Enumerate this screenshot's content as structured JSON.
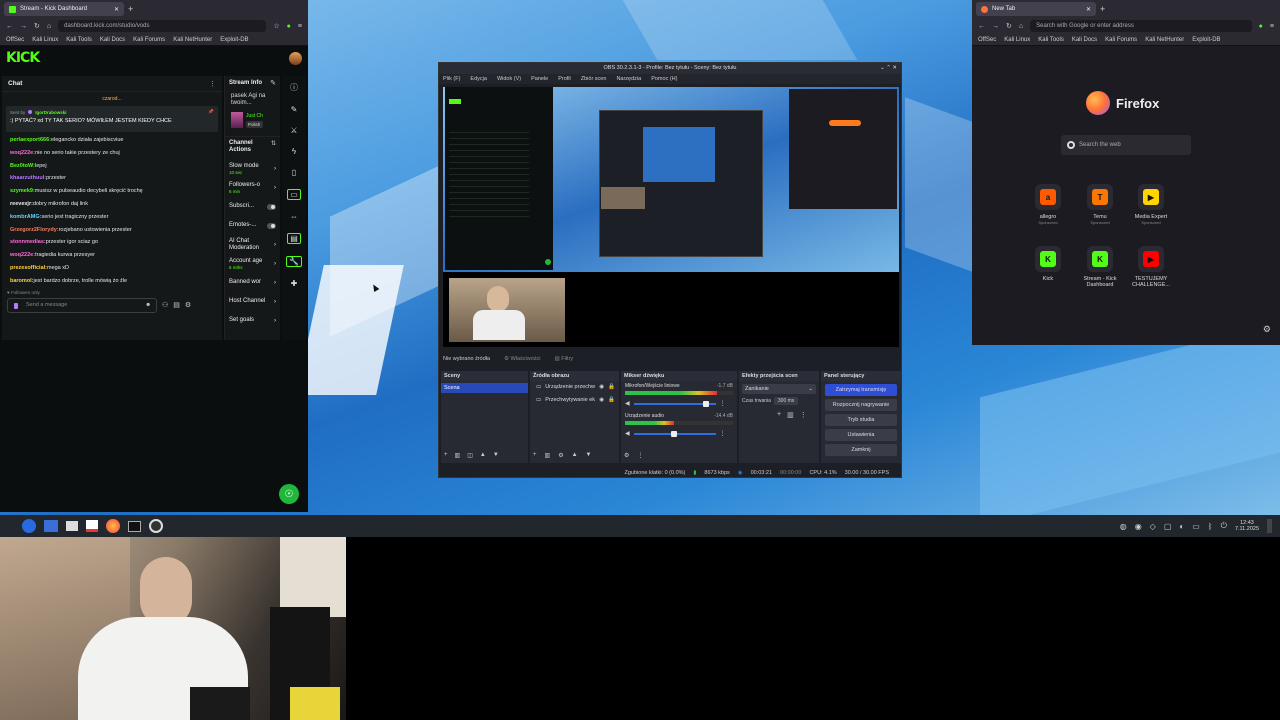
{
  "kick_window": {
    "tab_title": "Stream - Kick Dashboard",
    "url": "dashboard.kick.com/studio/vods",
    "bookmarks": [
      "OffSec",
      "Kali Linux",
      "Kali Tools",
      "Kali Docs",
      "Kali Forums",
      "Kali NetHunter",
      "Exploit-DB"
    ],
    "logo": "KICK",
    "chat_title": "Chat",
    "pinned_user_top": "czarod...",
    "pinned_sent_by": "Sent by",
    "pinned_user": "IgorDrabowski",
    "pinned_text": ":) PYTAĆ? xd TY TAK SERIO? MÓWIŁEM JESTEM KIEDY CHCE",
    "messages": [
      {
        "user": "perlaexport666:",
        "text": "elegancko działa zajebiscviue",
        "color": "#53fc18"
      },
      {
        "user": "woq222e:",
        "text": "nie no serio takie przestery ze chuj",
        "color": "#ff6bd6"
      },
      {
        "user": "Bez0toW:",
        "text": "lepej",
        "color": "#53fc18"
      },
      {
        "user": "khaarzuthuul:",
        "text": "przester",
        "color": "#b57bff"
      },
      {
        "user": "szymek9:",
        "text": "musisz w pulseaudio decybeli skręcić trochę",
        "color": "#53fc18"
      },
      {
        "user": "reevexjr:",
        "text": "dobry mikrofon daj link",
        "color": "#eeeeee"
      },
      {
        "user": "kombrAMG:",
        "text": "serio jest tragiczny przester",
        "color": "#6ad0ff"
      },
      {
        "user": "Grzegorz2Florydy:",
        "text": "rozjebano ustowienia przester",
        "color": "#ff7b5a"
      },
      {
        "user": "stonnmedias:",
        "text": "przester igor sciaz go",
        "color": "#ff6bd6"
      },
      {
        "user": "woq222e:",
        "text": "tragiedia kurwa przesyer",
        "color": "#ff6bd6"
      },
      {
        "user": "prezesofficial:",
        "text": "mega xD",
        "color": "#ffd23f"
      },
      {
        "user": "baromol:",
        "text": "jest bardzo dobrze, trolle mówią żo źle",
        "color": "#ffd23f"
      }
    ],
    "followers_only": "Followers only",
    "send_placeholder": "Send a message",
    "stream_info_title": "Stream Info",
    "stream_title_snip": "pasek Agi na twoim...",
    "category_tag": "Just Ch",
    "language_tag": "Polish",
    "channel_actions_title": "Channel Actions",
    "actions": [
      {
        "label": "Slow mode",
        "sub": "10 sec"
      },
      {
        "label": "Followers-o",
        "sub": "6 min"
      },
      {
        "label": "Subscri...",
        "sub": ""
      },
      {
        "label": "Emotes-...",
        "sub": ""
      },
      {
        "label": "AI Chat Moderation",
        "sub": ""
      },
      {
        "label": "Account age",
        "sub": "6 mths"
      },
      {
        "label": "Banned wor",
        "sub": ""
      },
      {
        "label": "Host Channel",
        "sub": ""
      },
      {
        "label": "Set goals",
        "sub": ""
      }
    ]
  },
  "obs_window": {
    "title": "OBS 30.2.3.1-3 - Profile: Bez tytułu - Sceny: Bez tytułu",
    "menu": [
      "Plik (F)",
      "Edycja",
      "Widok (V)",
      "Panele",
      "Profil",
      "Zbiór scen",
      "Narzędzia",
      "Pomoc (H)"
    ],
    "no_source": "Nie wybrano źródła",
    "properties": "Właściwości",
    "filters": "Filtry",
    "panels": {
      "scenes": "Sceny",
      "sources": "Źródła obrazu",
      "mixer": "Mikser dźwięku",
      "transitions": "Efekty przejścia scen",
      "controls": "Panel sterujący"
    },
    "scene_item": "Scena",
    "sources_list": [
      "Urządzenie przechw",
      "Przechwytywanie ek"
    ],
    "mixer_tracks": [
      {
        "name": "Mikrofon/Wejście liniowe",
        "db": "-1.7 dB",
        "level": 0.85
      },
      {
        "name": "Urządzenie audio",
        "db": "-14.4 dB",
        "level": 0.45
      }
    ],
    "transition_type": "Zanikanie",
    "duration_label": "Czas trwania",
    "duration_value": "300 ms",
    "controls": [
      "Zatrzymaj transmisję",
      "Rozpocznij nagrywanie",
      "Tryb studia",
      "Ustawienia",
      "Zamknij"
    ],
    "status": {
      "dropped": "Zgubione klatki: 0 (0.0%)",
      "bitrate": "8673 kbps",
      "live_time": "00:03:21",
      "rec_time": "00:00:00",
      "cpu": "CPU: 4.1%",
      "fps": "30.00 / 30.00 FPS"
    }
  },
  "firefox_window": {
    "tab_title": "New Tab",
    "url_placeholder": "Search with Google or enter address",
    "bookmarks": [
      "OffSec",
      "Kali Linux",
      "Kali Tools",
      "Kali Docs",
      "Kali Forums",
      "Kali NetHunter",
      "Exploit-DB"
    ],
    "brand": "Firefox",
    "search_placeholder": "Search the web",
    "tiles": [
      {
        "label": "allegro",
        "sub": "Sponsored",
        "color": "#ff5a00",
        "glyph": "a"
      },
      {
        "label": "Temu",
        "sub": "Sponsored",
        "color": "#fb7701",
        "glyph": "T"
      },
      {
        "label": "Media Expert",
        "sub": "Sponsored",
        "color": "#ffd400",
        "glyph": "▶"
      },
      {
        "label": "Kick",
        "sub": "",
        "color": "#53fc18",
        "glyph": "K"
      },
      {
        "label": "Stream - Kick Dashboard",
        "sub": "",
        "color": "#53fc18",
        "glyph": "K"
      },
      {
        "label": "TESTUJEMY CHALLENGE...",
        "sub": "",
        "color": "#ff0000",
        "glyph": "▶"
      }
    ]
  },
  "taskbar": {
    "time": "12:43",
    "date": "7.11.2025"
  }
}
